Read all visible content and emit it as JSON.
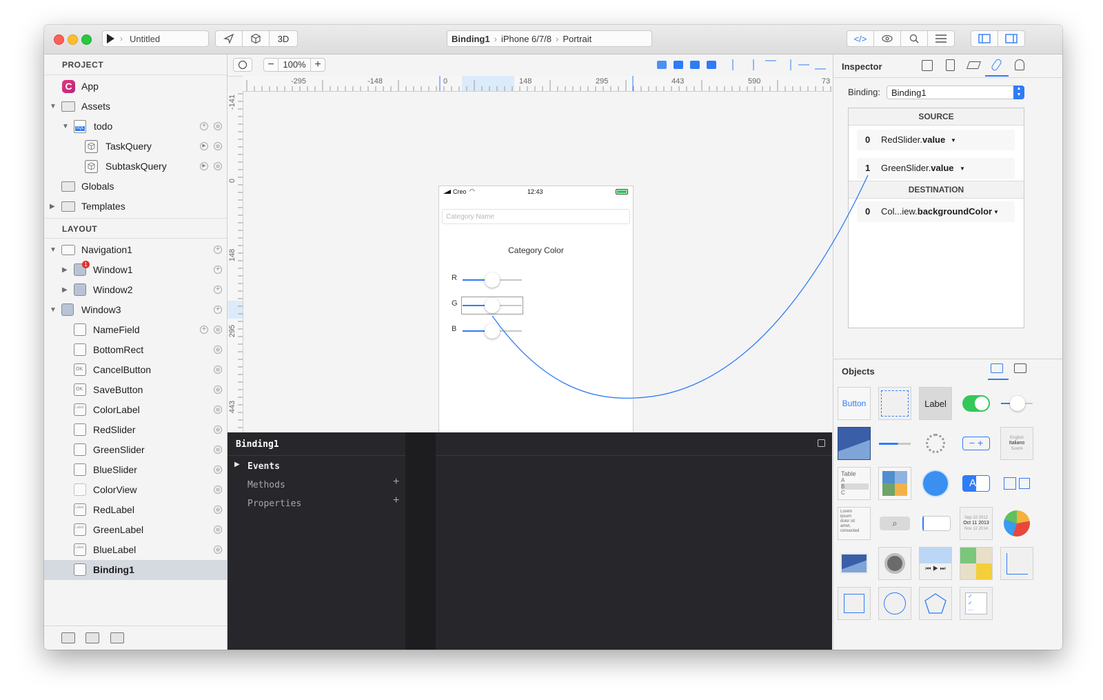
{
  "toolbar": {
    "run_icon": "play-icon",
    "scheme": "Untitled",
    "view_3d_label": "3D",
    "breadcrumb": [
      "Binding1",
      "iPhone 6/7/8",
      "Portrait"
    ]
  },
  "project": {
    "title": "PROJECT",
    "items": [
      {
        "label": "App",
        "icon": "app-icon"
      },
      {
        "label": "Assets",
        "icon": "folder-icon"
      },
      {
        "label": "todo",
        "icon": "sql-database-icon",
        "badge": "SQL"
      },
      {
        "label": "TaskQuery",
        "icon": "cube-icon"
      },
      {
        "label": "SubtaskQuery",
        "icon": "cube-icon"
      },
      {
        "label": "Globals",
        "icon": "folder-icon"
      },
      {
        "label": "Templates",
        "icon": "folder-icon"
      }
    ]
  },
  "layout": {
    "title": "LAYOUT",
    "items": [
      {
        "label": "Navigation1"
      },
      {
        "label": "Window1",
        "badge": "1"
      },
      {
        "label": "Window2"
      },
      {
        "label": "Window3"
      },
      {
        "label": "NameField"
      },
      {
        "label": "BottomRect"
      },
      {
        "label": "CancelButton",
        "tag": "OK"
      },
      {
        "label": "SaveButton",
        "tag": "OK"
      },
      {
        "label": "ColorLabel",
        "tag": "Label"
      },
      {
        "label": "RedSlider"
      },
      {
        "label": "GreenSlider"
      },
      {
        "label": "BlueSlider"
      },
      {
        "label": "ColorView"
      },
      {
        "label": "RedLabel",
        "tag": "Label"
      },
      {
        "label": "GreenLabel",
        "tag": "Label"
      },
      {
        "label": "BlueLabel",
        "tag": "Label"
      },
      {
        "label": "Binding1"
      }
    ]
  },
  "canvas": {
    "zoom": "100%",
    "ruler_h": [
      "-295",
      "-148",
      "0",
      "148",
      "295",
      "443",
      "590",
      "73"
    ],
    "ruler_v": [
      "-141",
      "0",
      "148",
      "295",
      "443"
    ]
  },
  "phone": {
    "carrier": "Creo",
    "time": "12:43",
    "placeholder": "Category Name",
    "title": "Category Color",
    "sliders": [
      {
        "label": "R",
        "value": 0.5
      },
      {
        "label": "G",
        "value": 0.5
      },
      {
        "label": "B",
        "value": 0.5
      }
    ]
  },
  "console": {
    "title": "Binding1",
    "items": [
      "Events",
      "Methods",
      "Properties"
    ],
    "add_symbol": "+"
  },
  "inspector": {
    "title": "Inspector",
    "binding_label": "Binding:",
    "binding_value": "Binding1",
    "source_title": "SOURCE",
    "destination_title": "DESTINATION",
    "sources": [
      {
        "index": "0",
        "object": "RedSlider.",
        "property": "value"
      },
      {
        "index": "1",
        "object": "GreenSlider.",
        "property": "value"
      }
    ],
    "destinations": [
      {
        "index": "0",
        "object": "Col...iew.",
        "property": "backgroundColor"
      }
    ]
  },
  "objects": {
    "title": "Objects",
    "button_label": "Button",
    "label_label": "Label",
    "picker_items": [
      "English",
      "Italiano",
      "Suomi"
    ],
    "table_items": [
      "Table",
      "A",
      "B",
      "C"
    ],
    "text_sample": "Lorem ipsum dolor sit amet, consected",
    "date_items": [
      "Sep 10 2012",
      "Oct 11 2013",
      "Nov 12 2014"
    ],
    "ab_label": "AB"
  },
  "colors": {
    "accent": "#2f7cf6",
    "toggle_green": "#34c759",
    "console_bg": "#27272b"
  }
}
